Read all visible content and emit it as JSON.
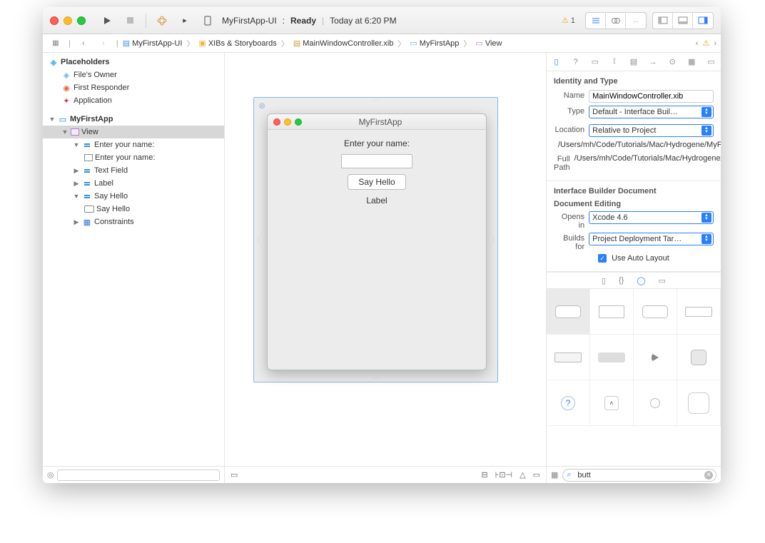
{
  "toolbar": {
    "project": "MyFirstApp-UI",
    "status": "Ready",
    "time": "Today at 6:20 PM",
    "warnings": "1"
  },
  "pathbar": {
    "items": [
      "MyFirstApp-UI",
      "XIBs & Storyboards",
      "MainWindowController.xib",
      "MyFirstApp",
      "View"
    ]
  },
  "outline": {
    "placeholders_header": "Placeholders",
    "files_owner": "File's Owner",
    "first_responder": "First Responder",
    "application": "Application",
    "window": "MyFirstApp",
    "view": "View",
    "enter1": "Enter your name:",
    "enter2": "Enter your name:",
    "textfield": "Text Field",
    "label": "Label",
    "sayhello1": "Say Hello",
    "sayhello2": "Say Hello",
    "constraints": "Constraints"
  },
  "preview": {
    "title": "MyFirstApp",
    "enter": "Enter your name:",
    "button": "Say Hello",
    "label": "Label"
  },
  "inspector": {
    "identity_header": "Identity and Type",
    "name_label": "Name",
    "name": "MainWindowController.xib",
    "type_label": "Type",
    "type": "Default - Interface Buil…",
    "location_label": "Location",
    "location": "Relative to Project",
    "path": "/Users/mh/Code/Tutorials/Mac/Hydrogene/MyFirstApp/MainWindowController.xib",
    "fullpath_label": "Full Path",
    "fullpath": "/Users/mh/Code/Tutorials/Mac/Hydrogene/MyFirstApp/MainWindowController.xib",
    "ibdoc_header": "Interface Builder Document",
    "doc_editing": "Document Editing",
    "opens_label": "Opens in",
    "opens": "Xcode 4.6",
    "builds_label": "Builds for",
    "builds": "Project Deployment Tar…",
    "auto_layout": "Use Auto Layout"
  },
  "library": {
    "search": "butt"
  }
}
